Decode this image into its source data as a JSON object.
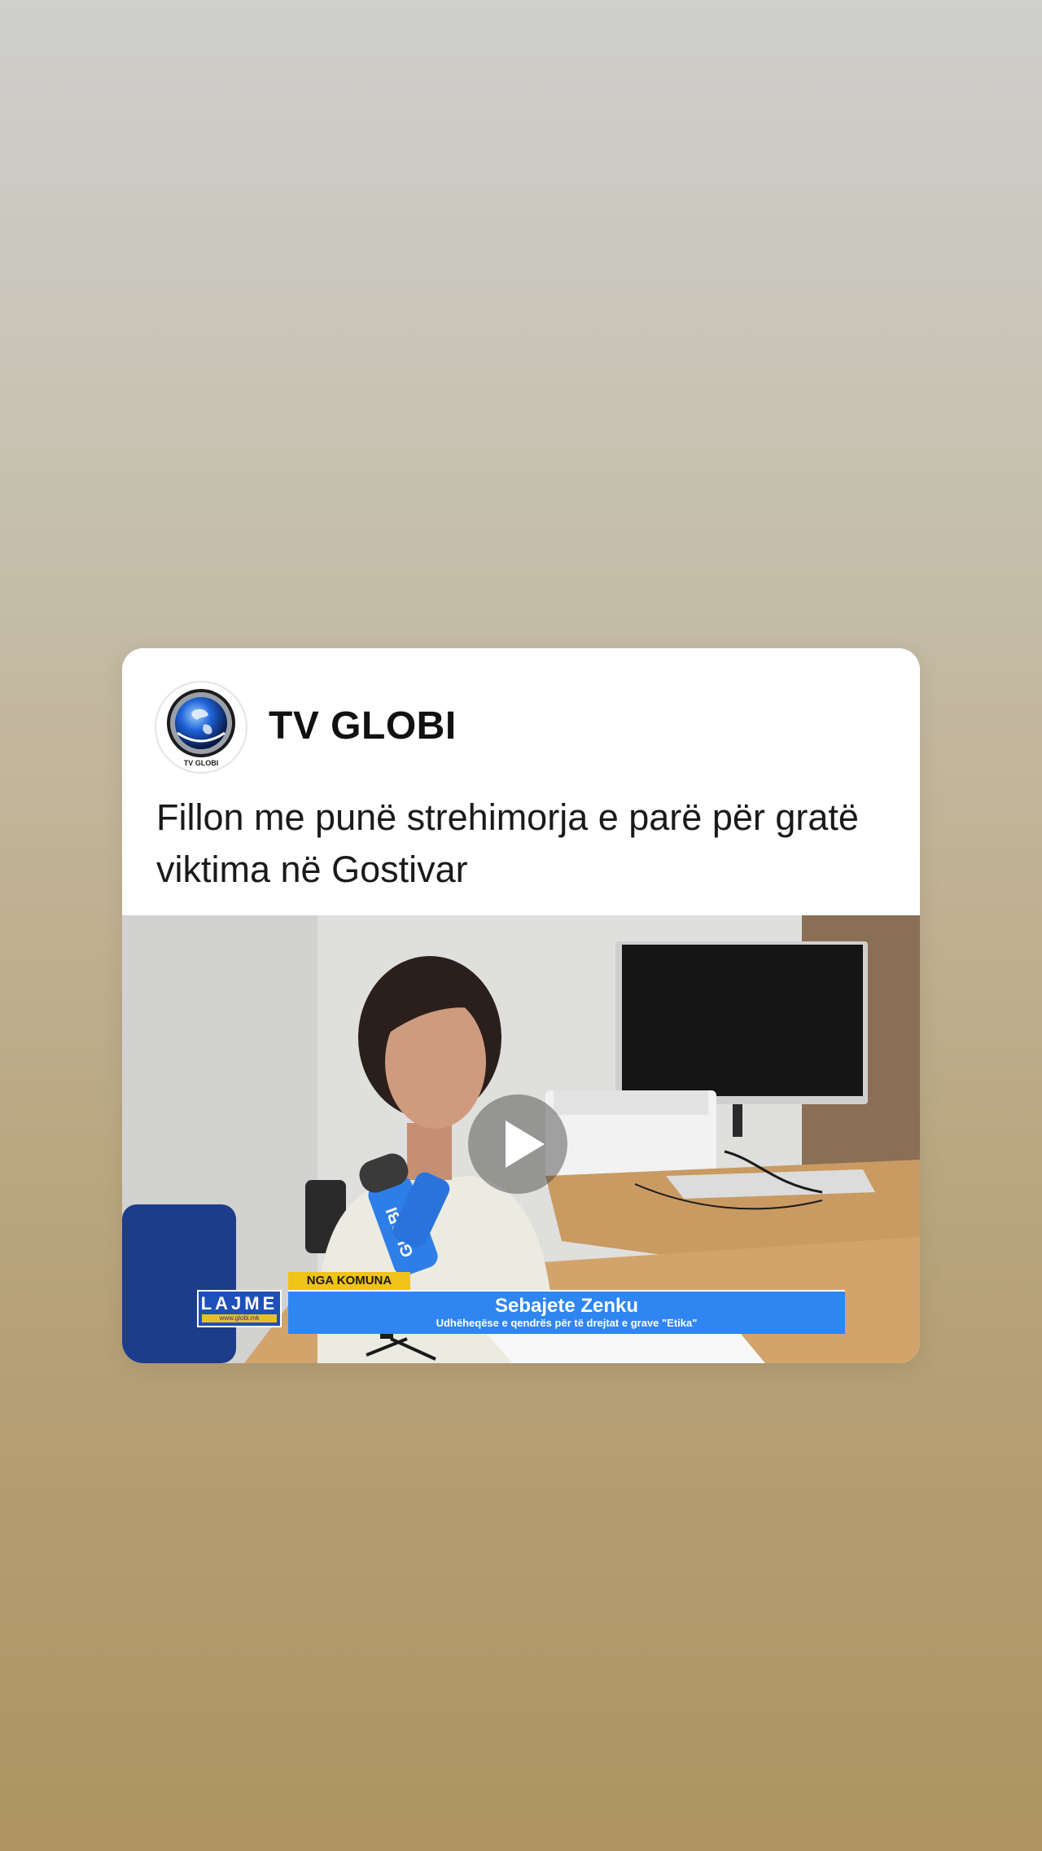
{
  "post": {
    "channel_name": "TV GLOBI",
    "avatar_label": "TV GLOBI",
    "title": "Fillon me punë strehimorja e parë për gratë viktima në Gostivar"
  },
  "video": {
    "brand_label": "LAJME",
    "brand_url": "www.globi.mk",
    "category_tag": "NGA KOMUNA",
    "guest_name": "Sebajete Zenku",
    "guest_role": "Udhëheqëse e qendrës për të drejtat e grave \"Etika\"",
    "mic_label": "GLOBI",
    "play_icon": "play-icon"
  },
  "colors": {
    "name_bar": "#2f86f0",
    "tag_yellow": "#f0c31a",
    "card_bg": "#ffffff"
  }
}
